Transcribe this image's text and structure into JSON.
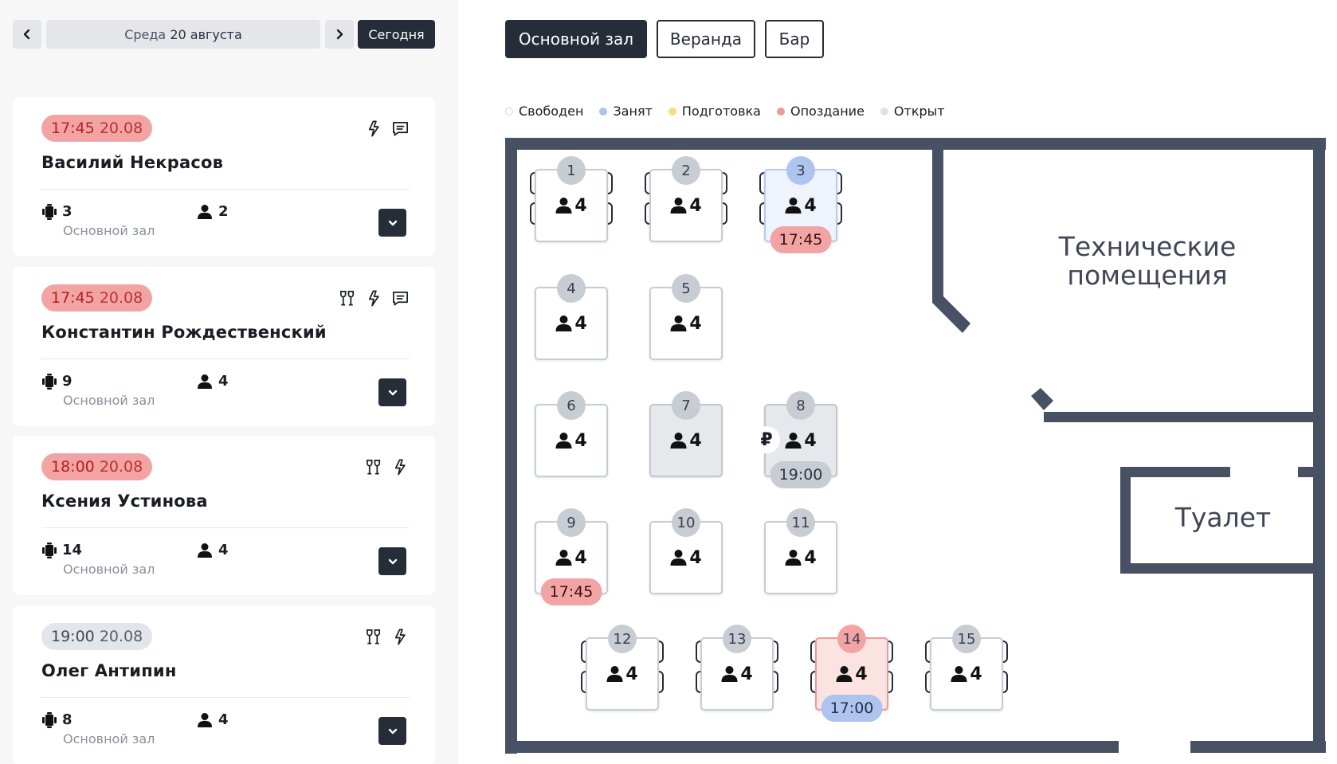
{
  "date_bar": {
    "weekday": "Среда",
    "date": "20 августа",
    "today_label": "Сегодня"
  },
  "reservations": [
    {
      "time": "17:45",
      "date": "20.08",
      "status": "late",
      "name": "Василий Некрасов",
      "icons": [
        "preorder-icon",
        "comment-icon"
      ],
      "table": "3",
      "hall": "Основной зал",
      "guests": "2"
    },
    {
      "time": "17:45",
      "date": "20.08",
      "status": "late",
      "name": "Константин Рождественский",
      "icons": [
        "wine-glasses-icon",
        "preorder-icon",
        "comment-icon"
      ],
      "table": "9",
      "hall": "Основной зал",
      "guests": "4"
    },
    {
      "time": "18:00",
      "date": "20.08",
      "status": "late",
      "name": "Ксения Устинова",
      "icons": [
        "wine-glasses-icon",
        "preorder-icon"
      ],
      "table": "14",
      "hall": "Основной зал",
      "guests": "4"
    },
    {
      "time": "19:00",
      "date": "20.08",
      "status": "upcoming",
      "name": "Олег Антипин",
      "icons": [
        "wine-glasses-icon",
        "preorder-icon"
      ],
      "table": "8",
      "hall": "Основной зал",
      "guests": "4"
    }
  ],
  "halls": {
    "tabs": [
      "Основной зал",
      "Веранда",
      "Бар"
    ],
    "active": "Основной зал"
  },
  "legend": [
    {
      "label": "Свободен",
      "color": "#ffffff"
    },
    {
      "label": "Занят",
      "color": "#aec4ee"
    },
    {
      "label": "Подготовка",
      "color": "#f8df6f"
    },
    {
      "label": "Опоздание",
      "color": "#ee9a9a"
    },
    {
      "label": "Открыт",
      "color": "#e0e2e6"
    }
  ],
  "rooms": {
    "tech": "Технические помещения",
    "wc": "Туалет"
  },
  "tables": [
    {
      "num": "1",
      "seats": "4",
      "state": "free"
    },
    {
      "num": "2",
      "seats": "4",
      "state": "free"
    },
    {
      "num": "3",
      "seats": "4",
      "state": "busy",
      "time": "17:45"
    },
    {
      "num": "4",
      "seats": "4",
      "state": "free"
    },
    {
      "num": "5",
      "seats": "4",
      "state": "free"
    },
    {
      "num": "6",
      "seats": "4",
      "state": "free"
    },
    {
      "num": "7",
      "seats": "4",
      "state": "open"
    },
    {
      "num": "8",
      "seats": "4",
      "state": "open",
      "time": "19:00",
      "payment": "₽"
    },
    {
      "num": "9",
      "seats": "4",
      "state": "free",
      "time": "17:45"
    },
    {
      "num": "10",
      "seats": "4",
      "state": "free"
    },
    {
      "num": "11",
      "seats": "4",
      "state": "free"
    },
    {
      "num": "12",
      "seats": "4",
      "state": "free"
    },
    {
      "num": "13",
      "seats": "4",
      "state": "free"
    },
    {
      "num": "14",
      "seats": "4",
      "state": "late",
      "time": "17:00"
    },
    {
      "num": "15",
      "seats": "4",
      "state": "free"
    }
  ]
}
